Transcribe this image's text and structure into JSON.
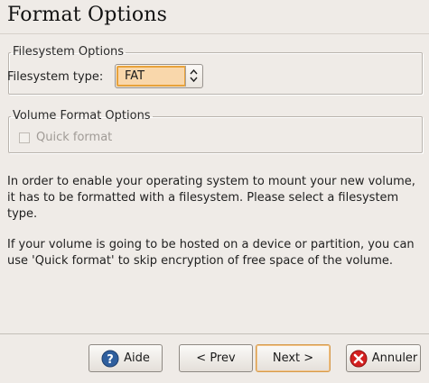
{
  "page": {
    "title": "Format Options"
  },
  "filesystem_options": {
    "legend": "Filesystem Options",
    "type_label": "Filesystem type:",
    "type_value": "FAT"
  },
  "volume_format_options": {
    "legend": "Volume Format Options",
    "quick_format_label": "Quick format",
    "quick_format_checked": false,
    "quick_format_enabled": false
  },
  "instructions": {
    "paragraph1": "In order to enable your operating system to mount your new volume, it has to be formatted with a filesystem. Please select a filesystem type.",
    "paragraph2": "If your volume is going to be hosted on a device or partition, you can use 'Quick format' to skip encryption of free space of the volume."
  },
  "buttons": {
    "help": "Aide",
    "prev": "< Prev",
    "next": "Next >",
    "cancel": "Annuler"
  },
  "colors": {
    "background": "#efebe7",
    "combo_highlight": "#f9d7ab",
    "combo_border": "#e8a23a",
    "help_icon": "#2f5f9e",
    "cancel_icon": "#d42020"
  },
  "icons": {
    "help": "help-icon",
    "cancel": "cancel-icon",
    "spinner": "up-down-arrows-icon"
  }
}
